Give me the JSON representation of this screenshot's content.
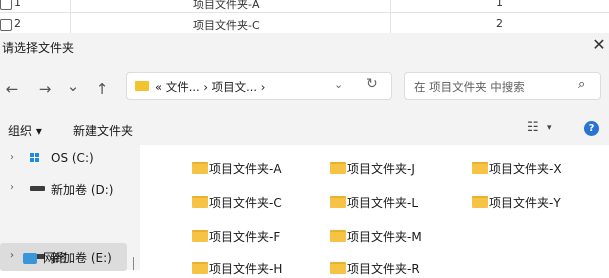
{
  "background_table": {
    "rows": [
      {
        "num": "1",
        "name": "项目文件夹-A",
        "value": "1"
      },
      {
        "num": "2",
        "name": "项目文件夹-C",
        "value": "2"
      }
    ]
  },
  "dialog": {
    "title": "请选择文件夹",
    "close_glyph": "✕",
    "nav": {
      "back": "←",
      "forward": "→",
      "recent": "⌄",
      "up": "↑"
    },
    "address": {
      "path": "« 文件... › 项目文... ›",
      "dropdown": "⌄",
      "refresh": "↻"
    },
    "search": {
      "placeholder": "在 项目文件夹 中搜索",
      "icon": "⌕"
    },
    "toolbar": {
      "organize_label": "组织 ▾",
      "new_folder_label": "新建文件夹",
      "view_glyph": "☷",
      "view_dropdown": "▾",
      "help_glyph": "?"
    },
    "sidebar": {
      "items": [
        {
          "label": "OS (C:)",
          "chevron": "›"
        },
        {
          "label": "新加卷 (D:)",
          "chevron": "›"
        },
        {
          "label": "新加卷 (E:)",
          "chevron": "›",
          "selected": true
        },
        {
          "label": "网络",
          "chevron": "›"
        }
      ]
    },
    "folders": [
      {
        "name": "项目文件夹-A"
      },
      {
        "name": "项目文件夹-J"
      },
      {
        "name": "项目文件夹-X"
      },
      {
        "name": "项目文件夹-C"
      },
      {
        "name": "项目文件夹-L"
      },
      {
        "name": "项目文件夹-Y"
      },
      {
        "name": "项目文件夹-F"
      },
      {
        "name": "项目文件夹-M"
      },
      {
        "name": "项目文件夹-H"
      },
      {
        "name": "项目文件夹-R"
      }
    ]
  },
  "colors": {
    "accent": "#2a74d1",
    "folder": "#f6c344",
    "selection": "#dcdcdc"
  }
}
